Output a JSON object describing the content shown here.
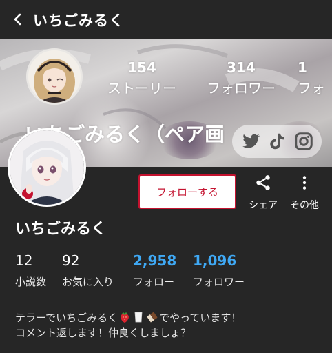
{
  "top_bar": {
    "title": "いちごみるく"
  },
  "header": {
    "stats": [
      {
        "value": "154",
        "label": "ストーリー"
      },
      {
        "value": "314",
        "label": "フォロワー"
      },
      {
        "value": "1",
        "label": "フォ"
      }
    ],
    "title": "いちごみるく（ペア画",
    "social_icons": [
      "twitter-icon",
      "tiktok-icon",
      "instagram-icon"
    ]
  },
  "actions": {
    "follow_label": "フォローする",
    "share_label": "シェア",
    "more_label": "その他"
  },
  "profile": {
    "name": "いちごみるく",
    "stats": [
      {
        "value": "12",
        "label": "小説数"
      },
      {
        "value": "92",
        "label": "お気に入り"
      },
      {
        "value": "2,958",
        "label": "フォロー"
      },
      {
        "value": "1,096",
        "label": "フォロワー"
      }
    ],
    "bio_line1_a": "テラーでいちごみるく",
    "bio_line1_b": "でやっています！",
    "bio_line2": "コメント返します！仲良くしましょ？"
  },
  "colors": {
    "background": "#262626",
    "accent_red": "#c4122f",
    "stat_blue": "#3fa9f5"
  }
}
